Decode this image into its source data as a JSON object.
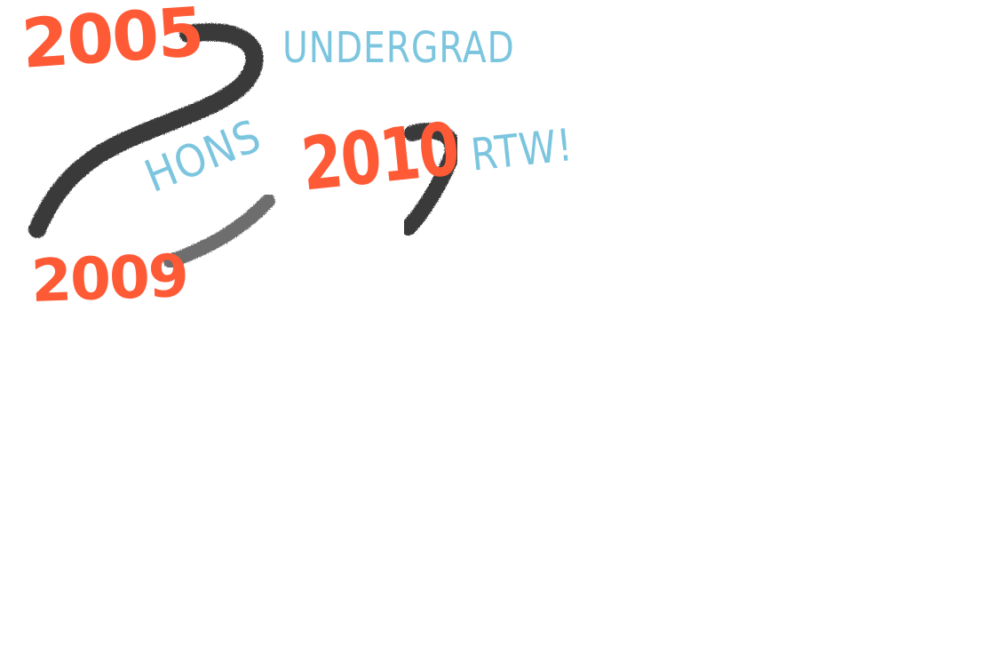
{
  "colors": {
    "year": "#ff5a36",
    "phase": "#7cc5df",
    "connector": "#2b2b2b"
  },
  "years": {
    "y2005": "2005",
    "y2009": "2009",
    "y2010": "2010"
  },
  "phases": {
    "undergrad": "UNDERGRAD",
    "hons": "HONS",
    "rtw": "RTW!"
  }
}
